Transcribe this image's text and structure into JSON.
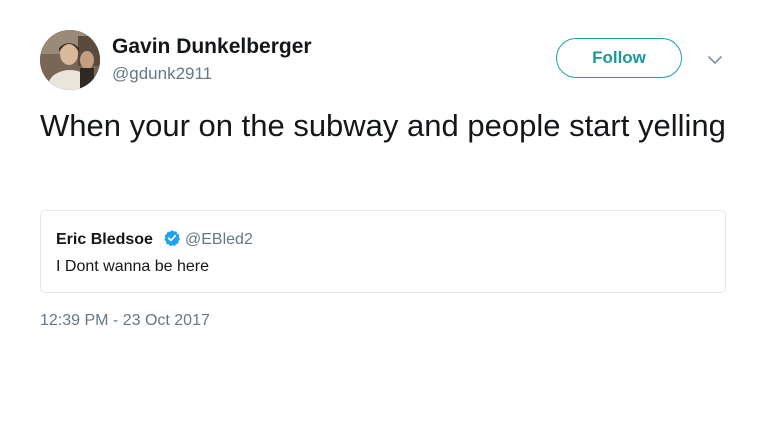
{
  "author": {
    "name": "Gavin Dunkelberger",
    "handle": "@gdunk2911"
  },
  "follow_label": "Follow",
  "tweet": {
    "text": "When your on the subway and people start yelling",
    "timestamp": "12:39 PM - 23 Oct 2017"
  },
  "quoted_tweet": {
    "name": "Eric Bledsoe",
    "handle": "@EBled2",
    "text": "I Dont wanna be here",
    "verified": true
  },
  "icons": {
    "more": "chevron-down-icon",
    "verified": "verified-badge-icon"
  },
  "colors": {
    "accent": "#1da1a1",
    "text": "#14171a",
    "secondary": "#657786",
    "border": "#e1e8ed",
    "verified": "#1da1f2"
  }
}
